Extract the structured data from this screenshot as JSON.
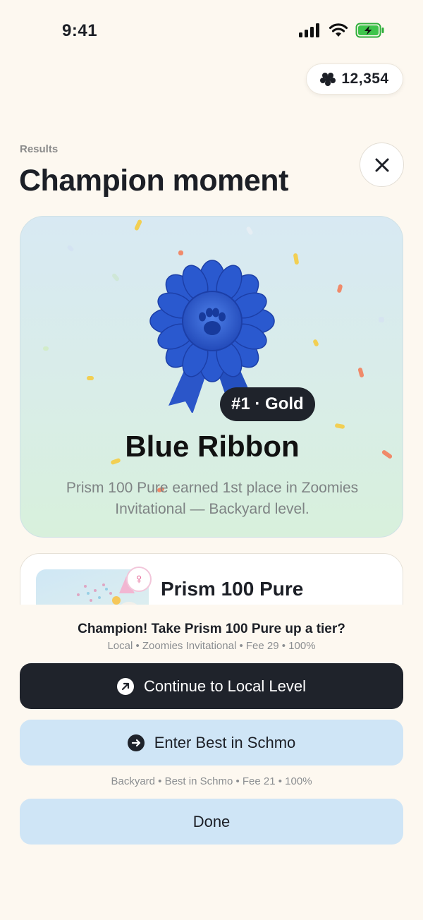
{
  "status_bar": {
    "time": "9:41"
  },
  "wallet": {
    "coins": "12,354",
    "icon": "paw-coin-icon"
  },
  "header": {
    "eyebrow": "Results",
    "title": "Champion moment",
    "close_icon": "close-icon"
  },
  "award": {
    "rank_badge": "#1 · Gold",
    "title": "Blue Ribbon",
    "description": "Prism 100 Pure earned 1st place in Zoomies Invitational — Backyard level.",
    "ribbon_color": "#2f5fd0"
  },
  "pet": {
    "name": "Prism 100 Pure",
    "gender_symbol": "♀"
  },
  "cta": {
    "headline": "Champion! Take Prism 100 Pure up a tier?",
    "meta_primary": "Local • Zoomies Invitational • Fee 29 • 100%",
    "primary_label": "Continue to Local Level",
    "secondary_label": "Enter Best in Schmo",
    "meta_secondary": "Backyard • Best in Schmo • Fee 21 • 100%",
    "done_label": "Done"
  },
  "colors": {
    "background": "#fdf8f0",
    "dark": "#1f232b",
    "light_blue": "#cfe5f6"
  }
}
